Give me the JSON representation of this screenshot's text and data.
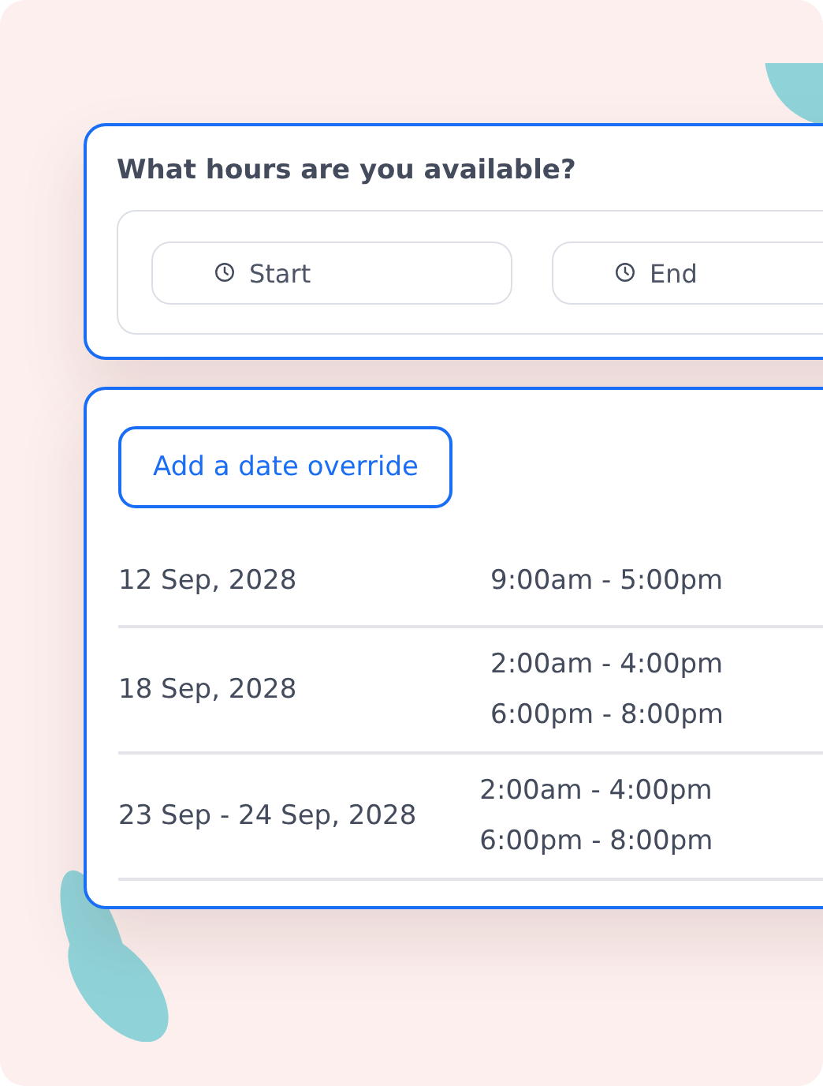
{
  "hours_card": {
    "title": "What hours are you available?",
    "fields": [
      {
        "placeholder": "Start"
      },
      {
        "placeholder": "End"
      }
    ]
  },
  "overrides_card": {
    "add_button": "Add a date override",
    "rows": [
      {
        "date": "12 Sep, 2028",
        "times": [
          "9:00am - 5:00pm"
        ]
      },
      {
        "date": "18 Sep, 2028",
        "times": [
          "2:00am - 4:00pm",
          "6:00pm - 8:00pm"
        ]
      },
      {
        "date": "23 Sep - 24 Sep, 2028",
        "times": [
          "2:00am - 4:00pm",
          "6:00pm - 8:00pm"
        ]
      }
    ]
  }
}
